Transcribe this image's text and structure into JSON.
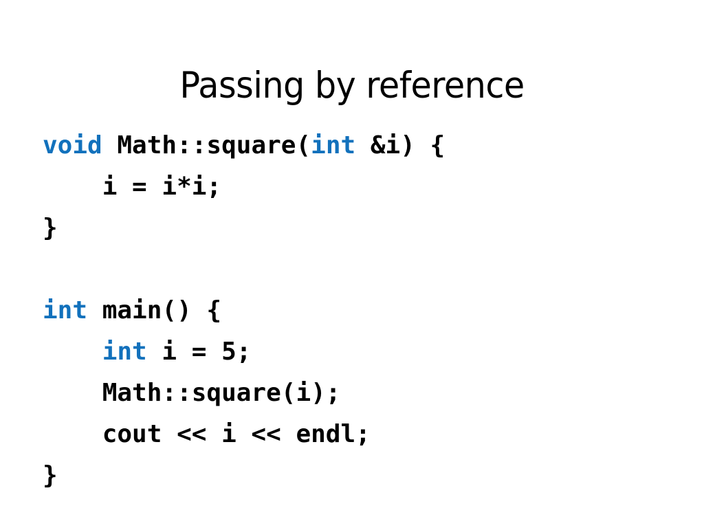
{
  "slide": {
    "background_color": "#ffffff",
    "title": "Passing by reference",
    "title_color": "#000000"
  },
  "code": {
    "language": "cpp",
    "keyword_color": "#1271BC",
    "text_color": "#000000",
    "lines": [
      {
        "text": "void Math::square(int &i) {",
        "tokens": [
          {
            "text": "void",
            "kind": "keyword"
          },
          {
            "text": " Math::square(",
            "kind": "plain"
          },
          {
            "text": "int",
            "kind": "keyword"
          },
          {
            "text": " &i) {",
            "kind": "plain"
          }
        ]
      },
      {
        "text": "    i = i*i;",
        "tokens": [
          {
            "text": "    i = i*i;",
            "kind": "plain"
          }
        ]
      },
      {
        "text": "}",
        "tokens": [
          {
            "text": "}",
            "kind": "plain"
          }
        ]
      },
      {
        "text": "",
        "tokens": []
      },
      {
        "text": "int main() {",
        "tokens": [
          {
            "text": "int",
            "kind": "keyword"
          },
          {
            "text": " main() {",
            "kind": "plain"
          }
        ]
      },
      {
        "text": "    int i = 5;",
        "tokens": [
          {
            "text": "    ",
            "kind": "plain"
          },
          {
            "text": "int",
            "kind": "keyword"
          },
          {
            "text": " i = 5;",
            "kind": "plain"
          }
        ]
      },
      {
        "text": "    Math::square(i);",
        "tokens": [
          {
            "text": "    Math::square(i);",
            "kind": "plain"
          }
        ]
      },
      {
        "text": "    cout << i << endl;",
        "tokens": [
          {
            "text": "    cout << i << endl;",
            "kind": "plain"
          }
        ]
      },
      {
        "text": "}",
        "tokens": [
          {
            "text": "}",
            "kind": "plain"
          }
        ]
      }
    ]
  }
}
